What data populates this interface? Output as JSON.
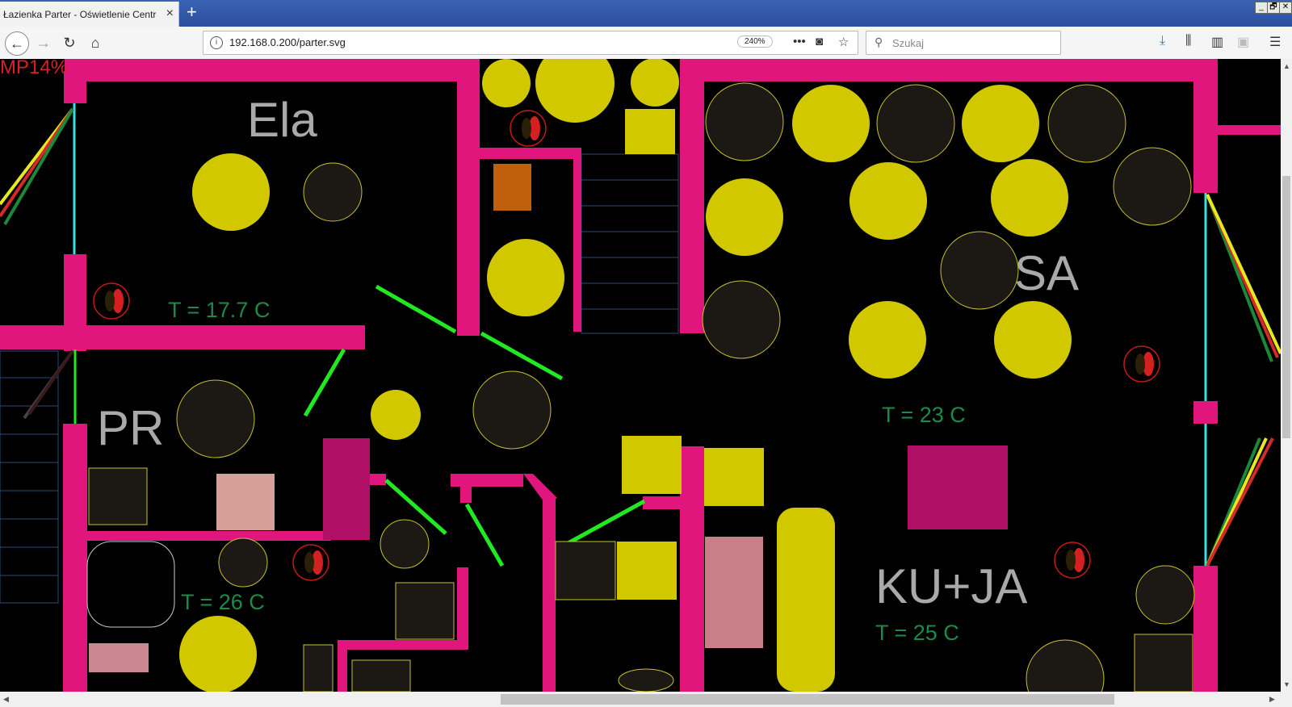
{
  "browser": {
    "tab_title": "Łazienka Parter - Oświetlenie Centralne",
    "tab_close_glyph": "×",
    "new_tab_glyph": "+",
    "url": "192.168.0.200/parter.svg",
    "zoom": "240%",
    "search_placeholder": "Szukaj",
    "window_controls": [
      "_",
      "🗗",
      "✕"
    ]
  },
  "floorplan": {
    "status_text": "MP14%",
    "rooms": {
      "ela": {
        "label": "Ela",
        "temp": "T = 17.7 C"
      },
      "pr": {
        "label": "PR",
        "temp": "T = 26 C"
      },
      "sa": {
        "label": "SA",
        "temp": "T = 23 C"
      },
      "kuja": {
        "label": "KU+JA",
        "temp": "T = 25 C"
      }
    }
  },
  "colors": {
    "wall": "#e0167c",
    "lamp_on": "#d2c800",
    "lamp_off": "#1c1814",
    "door": "#22e822",
    "window": "#38e0e0",
    "temp_text": "#1c8a49",
    "status_text": "#d4222a"
  },
  "icons": [
    "back-icon",
    "forward-icon",
    "reload-icon",
    "home-icon",
    "info-icon",
    "more-icon",
    "pocket-icon",
    "bookmark-star-icon",
    "search-icon",
    "download-icon",
    "library-icon",
    "sidebar-icon",
    "menu-icon"
  ]
}
